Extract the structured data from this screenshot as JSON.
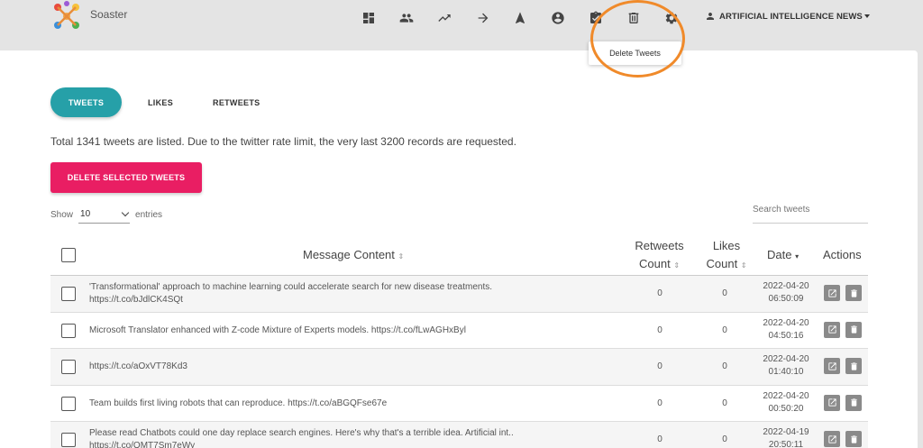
{
  "app": {
    "brand": "Soaster"
  },
  "nav": {
    "icons": [
      "dashboard-icon",
      "people-icon",
      "trending-up-icon",
      "arrow-forward-icon",
      "navigation-icon",
      "account-circle-icon",
      "clipboard-icon",
      "delete-icon",
      "settings-icon"
    ],
    "account_label": "ARTIFICIAL INTELLIGENCE NEWS"
  },
  "tooltip": {
    "text": "Delete Tweets"
  },
  "highlight_color": "#f08a2a",
  "tabs": [
    {
      "label": "TWEETS",
      "active": true
    },
    {
      "label": "LIKES",
      "active": false
    },
    {
      "label": "RETWEETS",
      "active": false
    }
  ],
  "summary": "Total 1341 tweets are listed. Due to the twitter rate limit, the very last 3200 records are requested.",
  "delete_button": "DELETE SELECTED TWEETS",
  "colors": {
    "accent": "#26a0a8",
    "danger": "#e91e63"
  },
  "length_menu": {
    "prefix": "Show",
    "value": "10",
    "suffix": "entries"
  },
  "search": {
    "placeholder": "Search tweets"
  },
  "table": {
    "headers": {
      "message": "Message Content",
      "retweets_line1": "Retweets",
      "retweets_line2": "Count",
      "likes_line1": "Likes",
      "likes_line2": "Count",
      "date": "Date",
      "actions": "Actions"
    },
    "rows": [
      {
        "line1": "'Transformational' approach to machine learning could accelerate search for new disease treatments.",
        "line2": "https://t.co/bJdlCK4SQt",
        "retweets": "0",
        "likes": "0",
        "date1": "2022-04-20",
        "date2": "06:50:09"
      },
      {
        "line1": "Microsoft Translator enhanced with Z-code Mixture of Experts models. https://t.co/fLwAGHxByl",
        "line2": "",
        "retweets": "0",
        "likes": "0",
        "date1": "2022-04-20",
        "date2": "04:50:16"
      },
      {
        "line1": "https://t.co/aOxVT78Kd3",
        "line2": "",
        "retweets": "0",
        "likes": "0",
        "date1": "2022-04-20",
        "date2": "01:40:10"
      },
      {
        "line1": "Team builds first living robots that can reproduce. https://t.co/aBGQFse67e",
        "line2": "",
        "retweets": "0",
        "likes": "0",
        "date1": "2022-04-20",
        "date2": "00:50:20"
      },
      {
        "line1": "Please read Chatbots could one day replace search engines. Here's why that's a terrible idea. Artificial int..",
        "line2": "https://t.co/OMT7Sm7eWy",
        "retweets": "0",
        "likes": "0",
        "date1": "2022-04-19",
        "date2": "20:50:11"
      }
    ]
  }
}
